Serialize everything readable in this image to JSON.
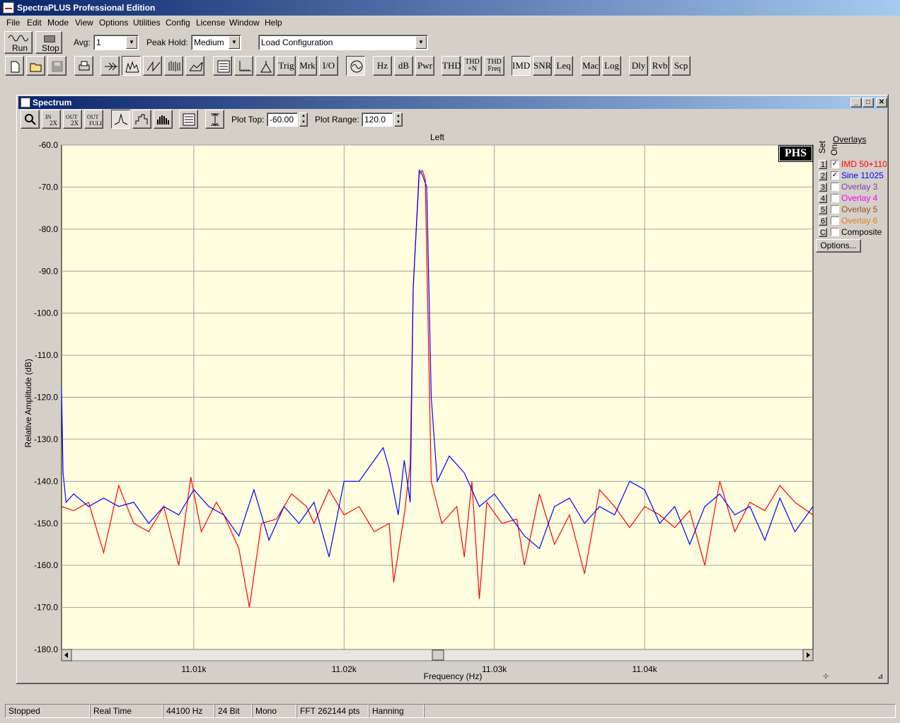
{
  "app": {
    "title": "SpectraPLUS Professional Edition"
  },
  "menu": [
    "File",
    "Edit",
    "Mode",
    "View",
    "Options",
    "Utilities",
    "Config",
    "License",
    "Window",
    "Help"
  ],
  "controls": {
    "run_label": "Run",
    "stop_label": "Stop",
    "avg_label": "Avg:",
    "avg_value": "1",
    "peak_hold_label": "Peak Hold:",
    "peak_hold_value": "Medium",
    "config_value": "Load Configuration"
  },
  "toolbar_text_buttons": [
    {
      "label": "Trig"
    },
    {
      "label": "Mrk"
    },
    {
      "label": "I/O"
    },
    {
      "label": "Hz"
    },
    {
      "label": "dB"
    },
    {
      "label": "Pwr"
    },
    {
      "label": "THD"
    },
    {
      "label": "THD +N"
    },
    {
      "label": "THD Freq"
    },
    {
      "label": "IMD",
      "active": true
    },
    {
      "label": "SNR"
    },
    {
      "label": "Leq"
    },
    {
      "label": "Mac"
    },
    {
      "label": "Log"
    },
    {
      "label": "Dly"
    },
    {
      "label": "Rvb"
    },
    {
      "label": "Scp"
    }
  ],
  "spectrum_window": {
    "title": "Spectrum",
    "plot_top_label": "Plot Top:",
    "plot_top_value": "-60.00",
    "plot_range_label": "Plot Range:",
    "plot_range_value": "120.0",
    "phs_badge": "PHS"
  },
  "overlays": {
    "title": "Overlays",
    "set_header": "Set",
    "on_header": "On",
    "items": [
      {
        "num": "1",
        "label": "IMD 50+110",
        "checked": true,
        "color": "#ff0000"
      },
      {
        "num": "2",
        "label": "Sine 11025",
        "checked": true,
        "color": "#0000ff"
      },
      {
        "num": "3",
        "label": "Overlay 3",
        "checked": false,
        "color": "#8040a0"
      },
      {
        "num": "4",
        "label": "Overlay 4",
        "checked": false,
        "color": "#ff00ff"
      },
      {
        "num": "5",
        "label": "Overlay 5",
        "checked": false,
        "color": "#a05020"
      },
      {
        "num": "6",
        "label": "Overlay 6",
        "checked": false,
        "color": "#e08020"
      },
      {
        "num": "C",
        "label": "Composite",
        "checked": false,
        "color": "#000000"
      }
    ],
    "options_label": "Options..."
  },
  "chart_data": {
    "type": "line",
    "title": "Left",
    "xlabel": "Frequency (Hz)",
    "ylabel": "Relative Amplitude (dB)",
    "xlim": [
      11001.2,
      11051.2
    ],
    "ylim": [
      -180,
      -60
    ],
    "yticks": [
      "-60.0",
      "-70.0",
      "-80.0",
      "-90.0",
      "-100.0",
      "-110.0",
      "-120.0",
      "-130.0",
      "-140.0",
      "-150.0",
      "-160.0",
      "-170.0",
      "-180.0"
    ],
    "xticks": [
      {
        "value": 11010,
        "label": "11.01k"
      },
      {
        "value": 11020,
        "label": "11.02k"
      },
      {
        "value": 11030,
        "label": "11.03k"
      },
      {
        "value": 11040,
        "label": "11.04k"
      }
    ],
    "grid": true,
    "background": "#ffffe0",
    "series": [
      {
        "name": "IMD 50+110",
        "color": "#ff0000",
        "x": [
          11001.2,
          11002,
          11003,
          11004,
          11005,
          11006,
          11007,
          11008,
          11009,
          11009.8,
          11010.5,
          11011.5,
          11012,
          11013,
          11013.7,
          11014.5,
          11015.5,
          11016.5,
          11017.5,
          11018,
          11019,
          11020,
          11021,
          11022,
          11023,
          11023.3,
          11024,
          11024.4,
          11024.6,
          11025,
          11025.2,
          11025.4,
          11025.8,
          11026.5,
          11027.5,
          11028,
          11028.5,
          11029,
          11029.5,
          11030.5,
          11031.5,
          11032,
          11033,
          11034,
          11035,
          11036,
          11037,
          11038,
          11039,
          11040,
          11041,
          11042,
          11043,
          11044,
          11045,
          11046,
          11047,
          11048,
          11049,
          11050,
          11051.2
        ],
        "y": [
          -146,
          -147,
          -145,
          -157,
          -141,
          -150,
          -152,
          -146,
          -160,
          -139,
          -152,
          -145,
          -148,
          -156,
          -170,
          -150,
          -149,
          -143,
          -146,
          -150,
          -142,
          -148,
          -146,
          -152,
          -150,
          -164,
          -148,
          -136,
          -94,
          -67,
          -66,
          -68,
          -140,
          -150,
          -146,
          -158,
          -140,
          -168,
          -145,
          -150,
          -149,
          -160,
          -143,
          -155,
          -148,
          -162,
          -142,
          -146,
          -151,
          -146,
          -148,
          -151,
          -147,
          -160,
          -140,
          -152,
          -145,
          -147,
          -141,
          -145,
          -148
        ]
      },
      {
        "name": "Sine 11025",
        "color": "#0000ff",
        "x": [
          11001.2,
          11001.3,
          11001.5,
          11002,
          11003,
          11004,
          11005,
          11006,
          11007,
          11008,
          11009,
          11010,
          11011,
          11012,
          11013,
          11014,
          11015,
          11016,
          11017,
          11018,
          11019,
          11020,
          11021,
          11022,
          11022.6,
          11023,
          11023.6,
          11024,
          11024.4,
          11024.6,
          11025,
          11025.2,
          11025.5,
          11025.8,
          11026.2,
          11027,
          11028,
          11029,
          11030,
          11031,
          11032,
          11033,
          11034,
          11035,
          11036,
          11037,
          11038,
          11039,
          11040,
          11041,
          11042,
          11043,
          11044,
          11045,
          11046,
          11047,
          11048,
          11049,
          11050,
          11051.2
        ],
        "y": [
          -118,
          -138,
          -145,
          -143,
          -146,
          -144,
          -146,
          -145,
          -150,
          -146,
          -148,
          -142,
          -146,
          -148,
          -153,
          -142,
          -154,
          -146,
          -150,
          -145,
          -158,
          -140,
          -140,
          -135,
          -132,
          -137,
          -148,
          -135,
          -145,
          -94,
          -66,
          -67,
          -70,
          -120,
          -140,
          -134,
          -138,
          -146,
          -143,
          -148,
          -153,
          -156,
          -146,
          -144,
          -150,
          -146,
          -148,
          -140,
          -142,
          -150,
          -146,
          -155,
          -146,
          -143,
          -148,
          -146,
          -154,
          -144,
          -152,
          -146
        ]
      }
    ]
  },
  "statusbar": [
    "Stopped",
    "Real Time",
    "44100 Hz",
    "24 Bit",
    "Mono",
    "FFT 262144 pts",
    "Hanning"
  ]
}
